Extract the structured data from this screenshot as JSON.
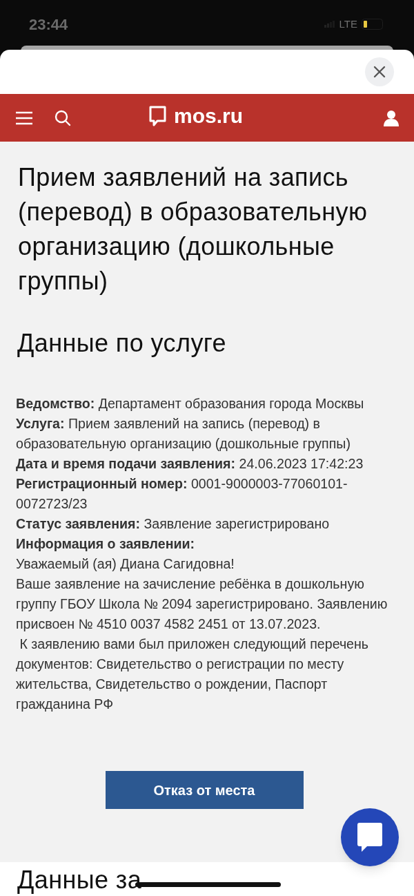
{
  "status_bar": {
    "time": "23:44",
    "network": "LTE"
  },
  "header": {
    "logo": "mos.ru"
  },
  "title": "Прием заявлений на запись (перевод) в образовательную организацию (дошкольные группы)",
  "section_title": "Данные по услуге",
  "details": [
    "**Ведомство:** Департамент образования города Москвы",
    "**Услуга:** Прием заявлений на запись (перевод) в образовательную организацию (дошкольные группы)",
    "**Дата и время подачи заявления:** 24.06.2023 17:42:23",
    "**Регистрационный номер:** 0001-9000003-77060101-0072723/23",
    "**Статус заявления:** Заявление зарегистрировано",
    "**Информация о заявлении:**",
    "Уважаемый (ая) Диана Сагидовна!",
    "Ваше заявление на зачисление ребёнка в дошкольную группу ГБОУ Школа № 2094 зарегистрировано. Заявлению присвоен № 4510 0037 4582 2451 от 13.07.2023.",
    " К заявлению вами был приложен следующий перечень документов: Свидетельство о регистрации по месту жительства, Свидетельство о рождении, Паспорт гражданина РФ"
  ],
  "action_button": "Отказ от места",
  "next_section_title": "Данные за"
}
